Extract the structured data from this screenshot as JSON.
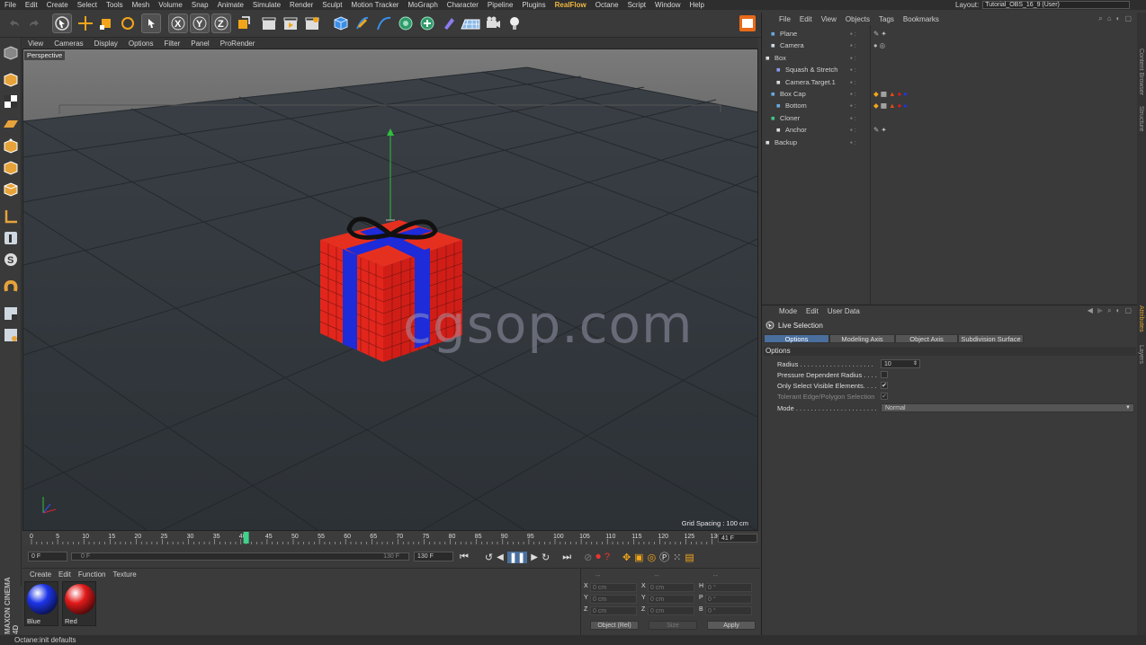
{
  "menubar": {
    "items": [
      "File",
      "Edit",
      "Create",
      "Select",
      "Tools",
      "Mesh",
      "Volume",
      "Snap",
      "Animate",
      "Simulate",
      "Render",
      "Sculpt",
      "Motion Tracker",
      "MoGraph",
      "Character",
      "Pipeline",
      "Plugins",
      "RealFlow",
      "Octane",
      "Script",
      "Window",
      "Help"
    ],
    "highlight": "RealFlow",
    "layout_label": "Layout:",
    "layout_value": "Tutorial_OBS_16_9 (User)"
  },
  "viewport": {
    "menu": [
      "View",
      "Cameras",
      "Display",
      "Options",
      "Filter",
      "Panel",
      "ProRender"
    ],
    "label": "Perspective",
    "grid_spacing": "Grid Spacing : 100 cm",
    "watermark": "cgsop.com"
  },
  "timeline": {
    "ticks": [
      "0",
      "5",
      "10",
      "15",
      "20",
      "25",
      "30",
      "35",
      "40",
      "45",
      "50",
      "55",
      "60",
      "65",
      "70",
      "75",
      "80",
      "85",
      "90",
      "95",
      "100",
      "105",
      "110",
      "115",
      "120",
      "125",
      "130"
    ],
    "current_frame": "41 F",
    "playhead_frame": 41,
    "range_start": "0 F",
    "range_slider_start": "0 F",
    "range_slider_end": "130 F",
    "range_end": "130 F"
  },
  "material_manager": {
    "menu": [
      "Create",
      "Edit",
      "Function",
      "Texture"
    ],
    "materials": [
      {
        "name": "Blue",
        "color": "#1d35e8"
      },
      {
        "name": "Red",
        "color": "#e21a1a"
      }
    ]
  },
  "coordinates": {
    "headers": [
      "--",
      "--",
      "--"
    ],
    "rows": [
      {
        "a": "X",
        "av": "0 cm",
        "b": "X",
        "bv": "0 cm",
        "c": "H",
        "cv": "0 °"
      },
      {
        "a": "Y",
        "av": "0 cm",
        "b": "Y",
        "bv": "0 cm",
        "c": "P",
        "cv": "0 °"
      },
      {
        "a": "Z",
        "av": "0 cm",
        "b": "Z",
        "bv": "0 cm",
        "c": "B",
        "cv": "0 °"
      }
    ],
    "mode": "Object (Rel)",
    "size": "Size",
    "apply": "Apply"
  },
  "object_manager": {
    "menu": [
      "File",
      "Edit",
      "View",
      "Objects",
      "Tags",
      "Bookmarks"
    ],
    "objects": [
      {
        "name": "Plane",
        "tags": [
          "tag-icons"
        ]
      },
      {
        "name": "Camera",
        "tags": [
          "camera-tags"
        ]
      },
      {
        "name": "Box",
        "tags": []
      },
      {
        "name": "Squash & Stretch",
        "tags": []
      },
      {
        "name": "Camera.Target.1",
        "tags": []
      },
      {
        "name": "Box Cap",
        "tags": [
          "material-tags"
        ]
      },
      {
        "name": "Bottom",
        "tags": [
          "material-tags"
        ]
      },
      {
        "name": "Cloner",
        "tags": []
      },
      {
        "name": "Anchor",
        "tags": [
          "tag-icons"
        ]
      },
      {
        "name": "Backup",
        "tags": []
      }
    ]
  },
  "attribute_manager": {
    "menu": [
      "Mode",
      "Edit",
      "User Data"
    ],
    "title": "Live Selection",
    "tabs": [
      "Options",
      "Modeling Axis",
      "Object Axis",
      "Subdivision Surface"
    ],
    "active_tab": "Options",
    "section": "Options",
    "options": [
      {
        "label": "Radius . . . . . . . . . . . . . . . . . . . .",
        "value": "10",
        "type": "number"
      },
      {
        "label": "Pressure Dependent Radius . . . .",
        "value": "",
        "type": "check",
        "checked": false
      },
      {
        "label": "Only Select Visible Elements. . . .",
        "value": "✔",
        "type": "check",
        "checked": true
      },
      {
        "label": "Tolerant Edge/Polygon Selection",
        "value": "✔",
        "type": "check",
        "checked": true,
        "disabled": true
      },
      {
        "label": "Mode . . . . . . . . . . . . . . . . . . . . . .",
        "value": "Normal",
        "type": "select"
      }
    ]
  },
  "right_strip": [
    "Content Browser",
    "Structure",
    "Attributes",
    "Layers"
  ],
  "status": "Octane:init defaults",
  "maxon_logo": "MAXON CINEMA 4D"
}
